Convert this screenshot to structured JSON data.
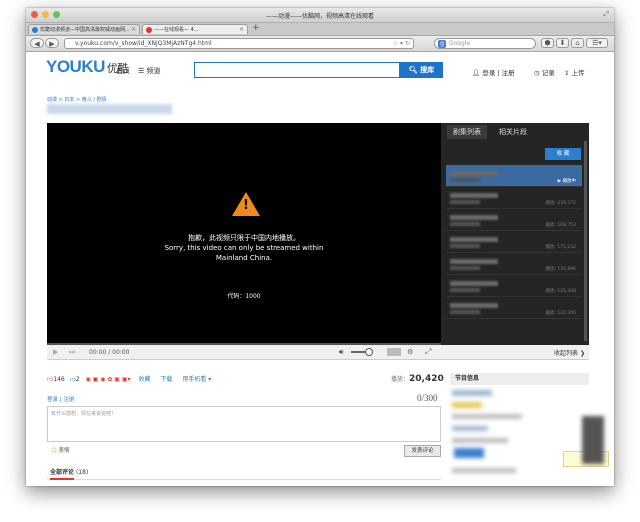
{
  "window": {
    "title": "——动漫——优酷网，视频高清在线观看",
    "traffic_lights": [
      "#ee5b54",
      "#f3bd3b",
      "#5fc454"
    ]
  },
  "tabs": [
    {
      "label": "优酷动漫频道—中国高清最权威动画网...",
      "favicon_color": "#2a7fd0",
      "active": false
    },
    {
      "label": "——在线观看— 4...",
      "favicon_color": "#e8332a",
      "active": true
    }
  ],
  "nav": {
    "url": "v.youku.com/v_show/id_XNjQ3MjAzNTg4.html",
    "search_placeholder": "Google",
    "buttons": [
      "◀",
      "▶"
    ]
  },
  "header": {
    "logo_main": "YOUKU",
    "logo_cn": "优酷",
    "home": "首页",
    "channel": "频道",
    "search_button": "搜库",
    "login": "登录 | 注册",
    "record": "记录",
    "upload": "上传"
  },
  "breadcrumb": "动漫 > 日本 > 格斗 / 剧情",
  "player": {
    "error_cn": "抱歉，此视频只限于中国内地播放。",
    "error_en_1": "Sorry, this video can only be streamed within",
    "error_en_2": "Mainland China.",
    "code": "代码：1000",
    "time": "00:00 / 00:00",
    "progress_fraction": 0.0
  },
  "playlist": {
    "tab_episodes": "剧集列表",
    "tab_related": "相关片段",
    "collect": "收 藏",
    "playing": "播放中",
    "collapse": "收起列表",
    "items": [
      {
        "plays": "播放中",
        "active": true
      },
      {
        "plays": "播放: 226,372"
      },
      {
        "plays": "播放: 168,703"
      },
      {
        "plays": "播放: 175,232"
      },
      {
        "plays": "播放: 126,896"
      },
      {
        "plays": "播放: 125,408"
      },
      {
        "plays": "播放: 120,306"
      }
    ]
  },
  "actions": {
    "likes": "146",
    "dislikes": "2",
    "favorite": "收藏",
    "download": "下载",
    "mobile": "用手机看",
    "plays_label": "播放：",
    "plays": "20,420"
  },
  "comments": {
    "login": "登录",
    "register": "注册",
    "counter": "0/300",
    "placeholder": "有什么感想，现在来说说吧！",
    "emoji": "表情",
    "post": "发表评论",
    "all_label": "全部评论",
    "count": "(18)"
  },
  "info": {
    "title": "节目信息"
  }
}
